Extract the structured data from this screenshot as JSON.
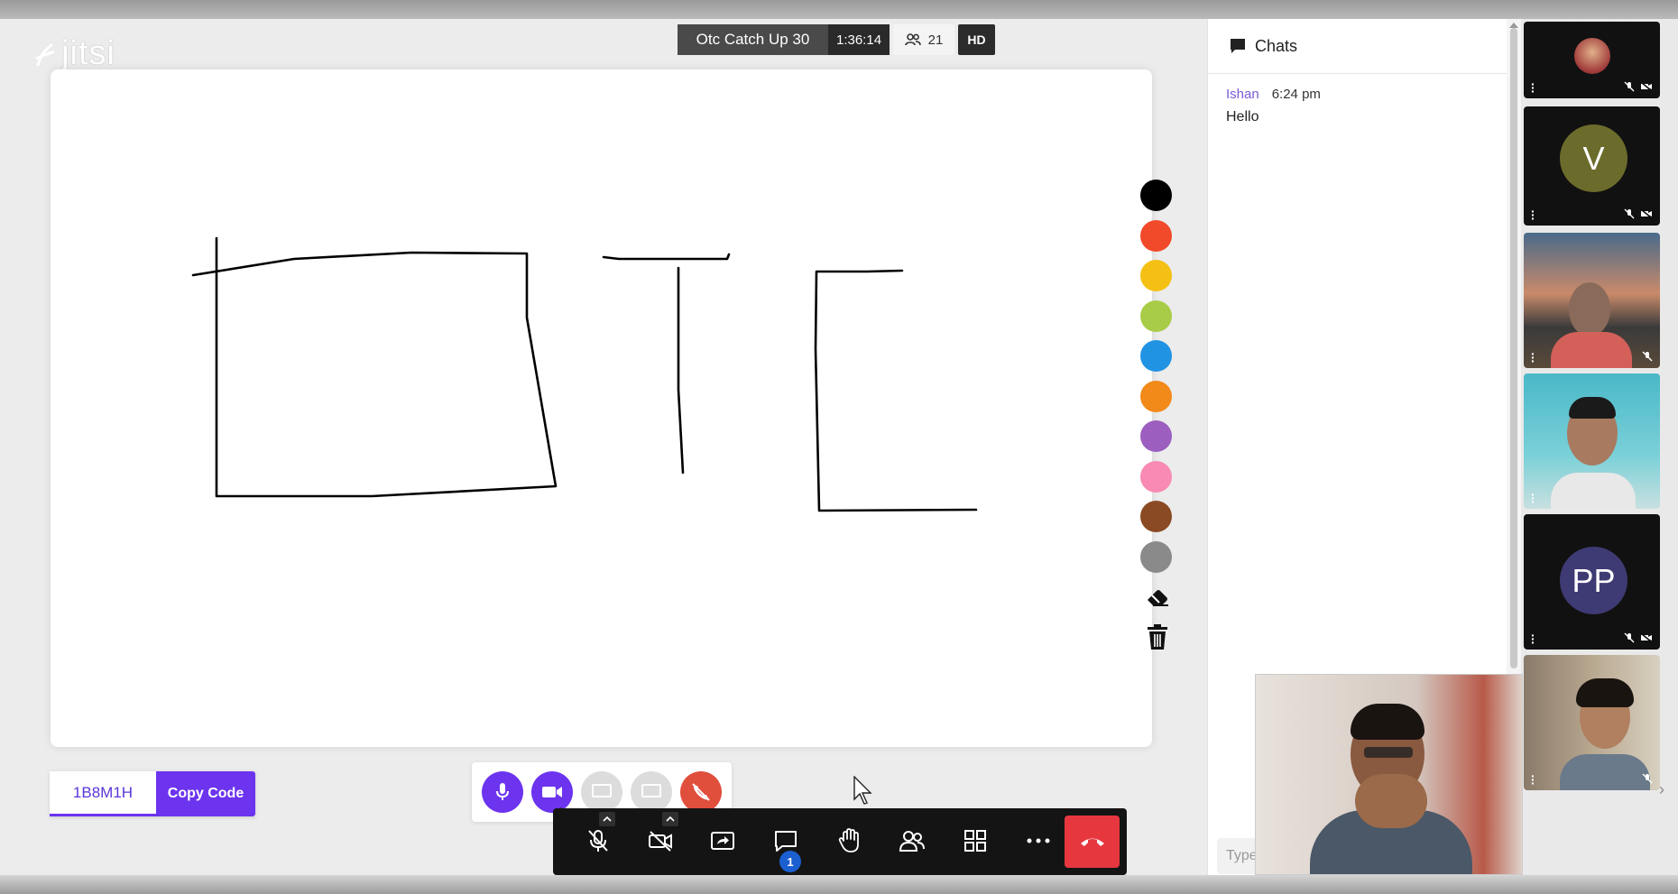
{
  "app": {
    "logo_text": "jitsi",
    "meeting_title": "Otc Catch Up 30",
    "duration": "1:36:14",
    "participant_count": "21",
    "quality": "HD"
  },
  "whiteboard": {
    "colors": [
      {
        "name": "black",
        "hex": "#000000"
      },
      {
        "name": "red-orange",
        "hex": "#f04a2a"
      },
      {
        "name": "yellow",
        "hex": "#f5c014"
      },
      {
        "name": "lime",
        "hex": "#a9cc48"
      },
      {
        "name": "blue",
        "hex": "#2193e3"
      },
      {
        "name": "orange",
        "hex": "#f28a1a"
      },
      {
        "name": "purple",
        "hex": "#9c5fc0"
      },
      {
        "name": "pink",
        "hex": "#f88ab3"
      },
      {
        "name": "brown",
        "hex": "#8a4a23"
      },
      {
        "name": "gray",
        "hex": "#8a8a8a"
      }
    ],
    "tools": [
      "eraser-icon",
      "trash-icon"
    ]
  },
  "room": {
    "code": "1B8M1H",
    "copy_label": "Copy Code"
  },
  "toolbar": {
    "chat_badge": "1"
  },
  "chat": {
    "title": "Chats",
    "messages": [
      {
        "sender": "Ishan",
        "time": "6:24 pm",
        "text": "Hello"
      }
    ],
    "input_placeholder": "Type"
  },
  "participants": [
    {
      "kind": "photo-avatar"
    },
    {
      "kind": "initials",
      "initials": "V",
      "color": "#6b6b2b"
    },
    {
      "kind": "video"
    },
    {
      "kind": "video"
    },
    {
      "kind": "initials",
      "initials": "PP",
      "color": "#3e3a73"
    },
    {
      "kind": "video"
    }
  ],
  "colors": {
    "accent": "#6c34ee",
    "hangup": "#e6373f",
    "toolbar_bg": "#141414"
  }
}
